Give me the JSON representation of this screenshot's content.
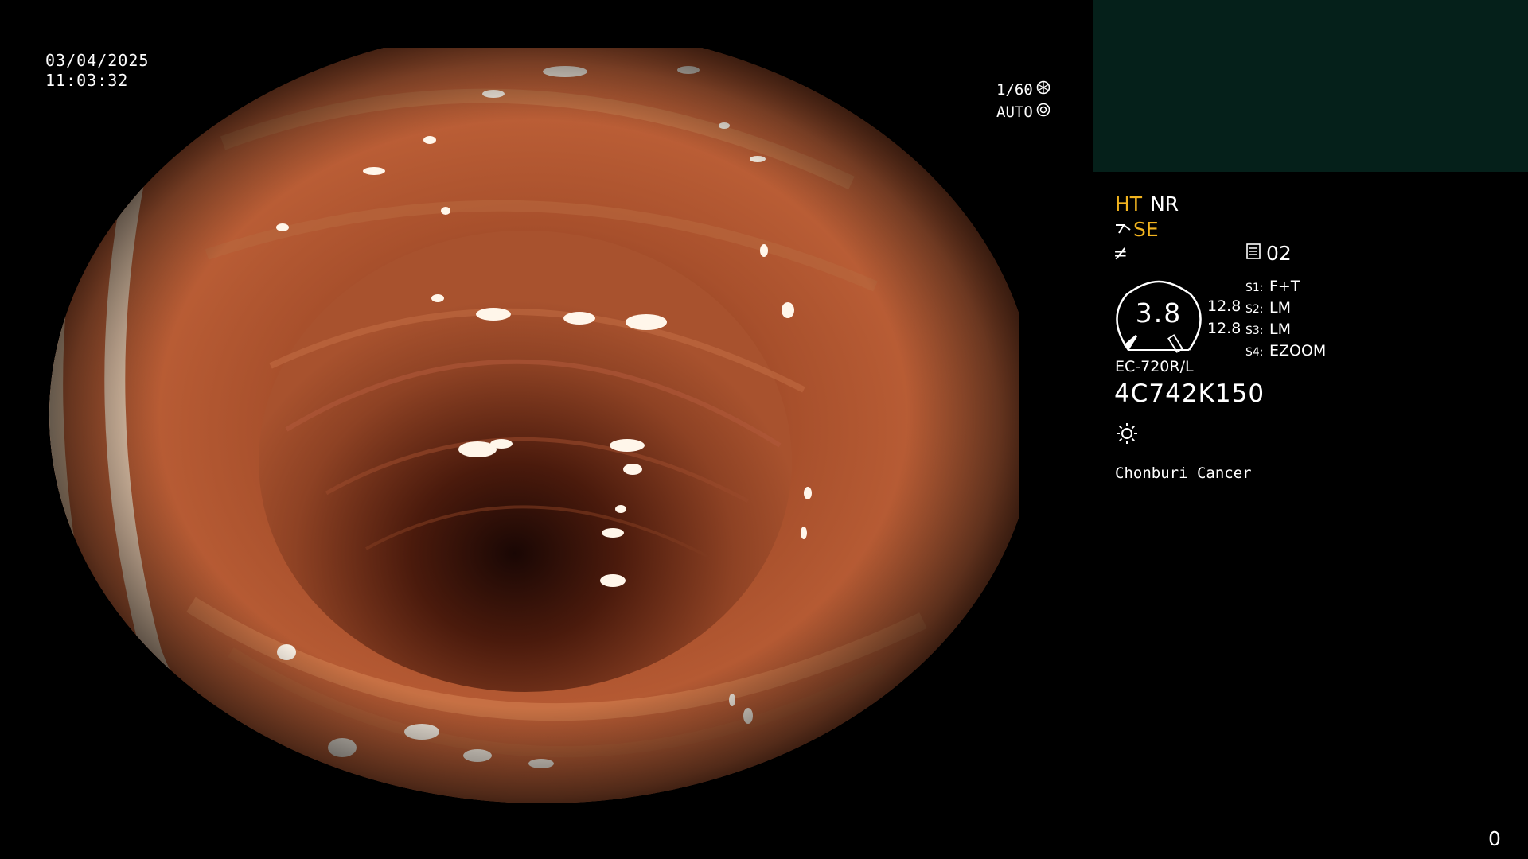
{
  "overlay": {
    "date": "03/04/2025",
    "time": "11:03:32",
    "shutter_speed": "1/60",
    "iris_mode": "AUTO",
    "shutter_icon": "shutter-icon",
    "iris_icon": "iris-icon"
  },
  "panel": {
    "mode_ht": "HT",
    "mode_nr": "NR",
    "mode_se": "SE",
    "filter_symbol": "≠",
    "memory_number": "02",
    "gauge_value": "3.8",
    "gauge_side_top": "12.8",
    "gauge_side_bottom": "12.8",
    "switches": [
      {
        "key": "S1:",
        "value": "F+T"
      },
      {
        "key": "S2:",
        "value": "LM"
      },
      {
        "key": "S3:",
        "value": "LM"
      },
      {
        "key": "S4:",
        "value": "EZOOM"
      }
    ],
    "scope_model": "EC-720R/L",
    "scope_serial": "4C742K150",
    "institution": "Chonburi Cancer",
    "counter": "0"
  },
  "colors": {
    "accent_yellow": "#f2b41f",
    "pip_background": "#05201a",
    "mucosa": "#b45a36"
  }
}
